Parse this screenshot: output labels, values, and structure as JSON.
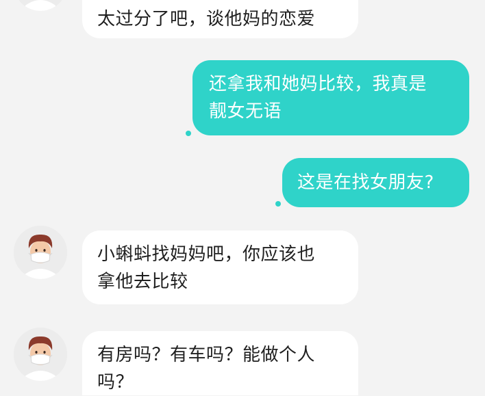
{
  "messages": [
    {
      "side": "in",
      "text": "太过分了吧，谈他妈的恋爱"
    },
    {
      "side": "out",
      "text_line1": "还拿我和她妈比较，我真是",
      "text_line2": "靓女无语"
    },
    {
      "side": "out",
      "text": "这是在找女朋友?"
    },
    {
      "side": "in",
      "text_line1": "小蝌蚪找妈妈吧，你应该也",
      "text_line2": "拿他去比较"
    },
    {
      "side": "in",
      "text_line1": "有房吗？有车吗？能做个人",
      "text_line2": "吗？"
    }
  ],
  "colors": {
    "background": "#f3f3f3",
    "incoming_bubble": "#ffffff",
    "outgoing_bubble": "#2fd3c9",
    "unread_dot": "#2fd3c9"
  },
  "icons": {
    "avatar": "masked-man-avatar-icon",
    "unread": "unread-dot-icon"
  }
}
